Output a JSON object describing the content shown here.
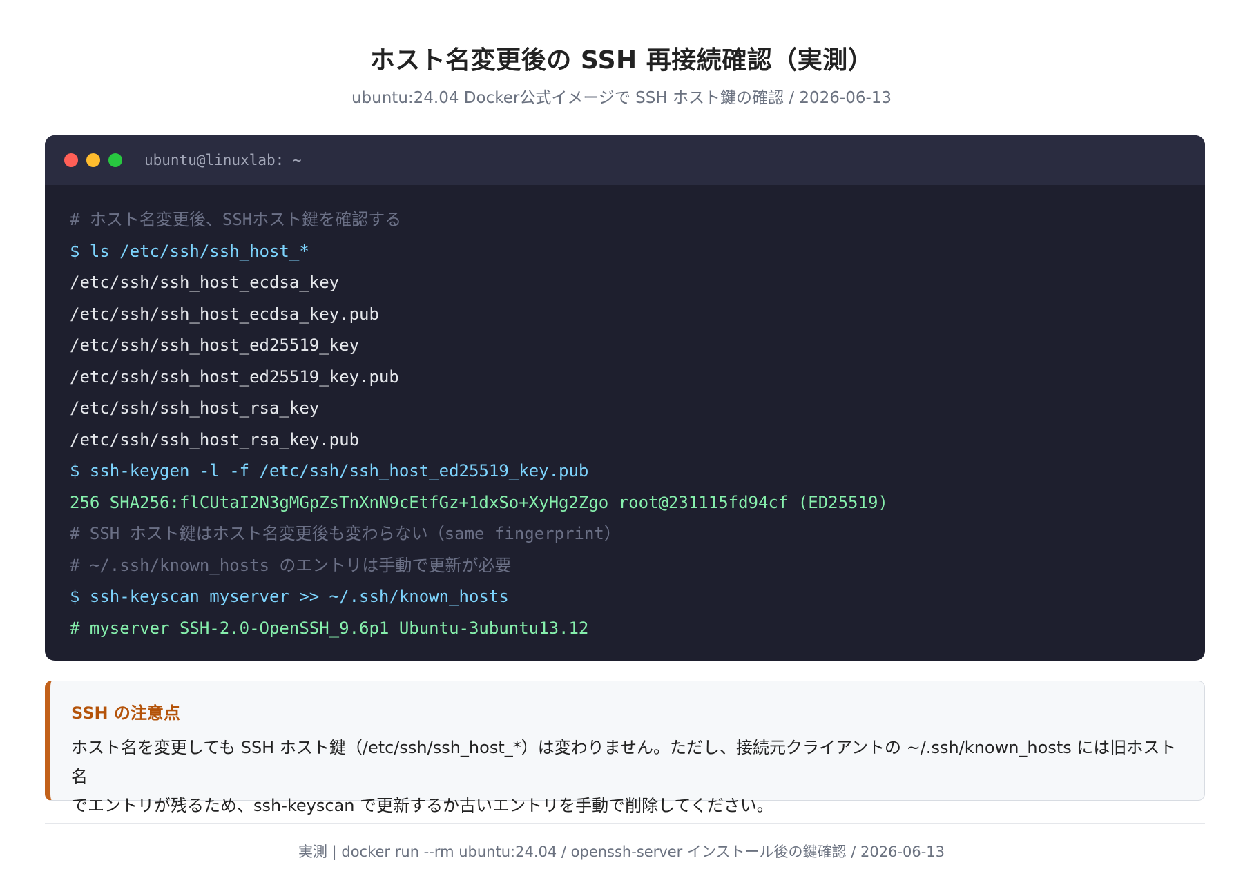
{
  "header": {
    "title": "ホスト名変更後の SSH 再接続確認（実測）",
    "subtitle": "ubuntu:24.04 Docker公式イメージで SSH ホスト鍵の確認 / 2026-06-13"
  },
  "terminal": {
    "title": "ubuntu@linuxlab: ~",
    "lines": [
      {
        "type": "comment",
        "text": "# ホスト名変更後、SSHホスト鍵を確認する"
      },
      {
        "type": "command",
        "text": "$ ls /etc/ssh/ssh_host_*"
      },
      {
        "type": "output",
        "text": "/etc/ssh/ssh_host_ecdsa_key"
      },
      {
        "type": "output",
        "text": "/etc/ssh/ssh_host_ecdsa_key.pub"
      },
      {
        "type": "output",
        "text": "/etc/ssh/ssh_host_ed25519_key"
      },
      {
        "type": "output",
        "text": "/etc/ssh/ssh_host_ed25519_key.pub"
      },
      {
        "type": "output",
        "text": "/etc/ssh/ssh_host_rsa_key"
      },
      {
        "type": "output",
        "text": "/etc/ssh/ssh_host_rsa_key.pub"
      },
      {
        "type": "command",
        "text": "$ ssh-keygen -l -f /etc/ssh/ssh_host_ed25519_key.pub"
      },
      {
        "type": "highlight",
        "text": "256 SHA256:flCUtaI2N3gMGpZsTnXnN9cEtfGz+1dxSo+XyHg2Zgo root@231115fd94cf (ED25519)"
      },
      {
        "type": "comment",
        "text": "# SSH ホスト鍵はホスト名変更後も変わらない（same fingerprint）"
      },
      {
        "type": "comment",
        "text": "# ~/.ssh/known_hosts のエントリは手動で更新が必要"
      },
      {
        "type": "command",
        "text": "$ ssh-keyscan myserver >> ~/.ssh/known_hosts"
      },
      {
        "type": "highlight",
        "text": "# myserver SSH-2.0-OpenSSH_9.6p1 Ubuntu-3ubuntu13.12"
      }
    ]
  },
  "callout": {
    "title": "SSH の注意点",
    "line1": "ホスト名を変更しても SSH ホスト鍵（/etc/ssh/ssh_host_*）は変わりません。ただし、接続元クライアントの ~/.ssh/known_hosts には旧ホスト名",
    "line2": "でエントリが残るため、ssh-keyscan で更新するか古いエントリを手動で削除してください。"
  },
  "footer": {
    "text": "実測 | docker run --rm ubuntu:24.04 / openssh-server インストール後の鍵確認 / 2026-06-13"
  },
  "colors": {
    "terminal_bg": "#1e1f2e",
    "titlebar_bg": "#2a2c40",
    "comment": "#6b7086",
    "command": "#7dd3fc",
    "output": "#e5e7eb",
    "highlight": "#86efac",
    "callout_accent": "#c2611a",
    "callout_title": "#b45309"
  }
}
